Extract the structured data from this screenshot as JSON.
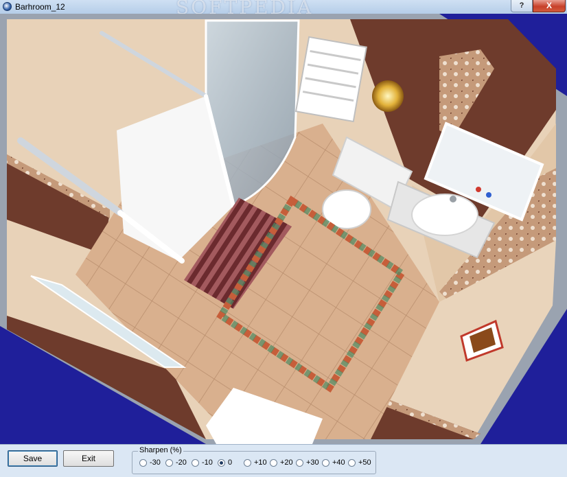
{
  "window": {
    "title": "Barhroom_12",
    "watermark": "SOFTPEDIA"
  },
  "title_buttons": {
    "help": "?",
    "close": "X"
  },
  "buttons": {
    "save": "Save",
    "exit": "Exit"
  },
  "sharpen": {
    "label": "Sharpen (%)",
    "selected": "0",
    "options": [
      "-30",
      "-20",
      "-10",
      "0",
      "+10",
      "+20",
      "+30",
      "+40",
      "+50"
    ]
  },
  "colors": {
    "background": "#1f1f9a",
    "floor": "#d9b08e",
    "wall_dark": "#6e3b2c",
    "wall_light": "#e8d2b8"
  }
}
